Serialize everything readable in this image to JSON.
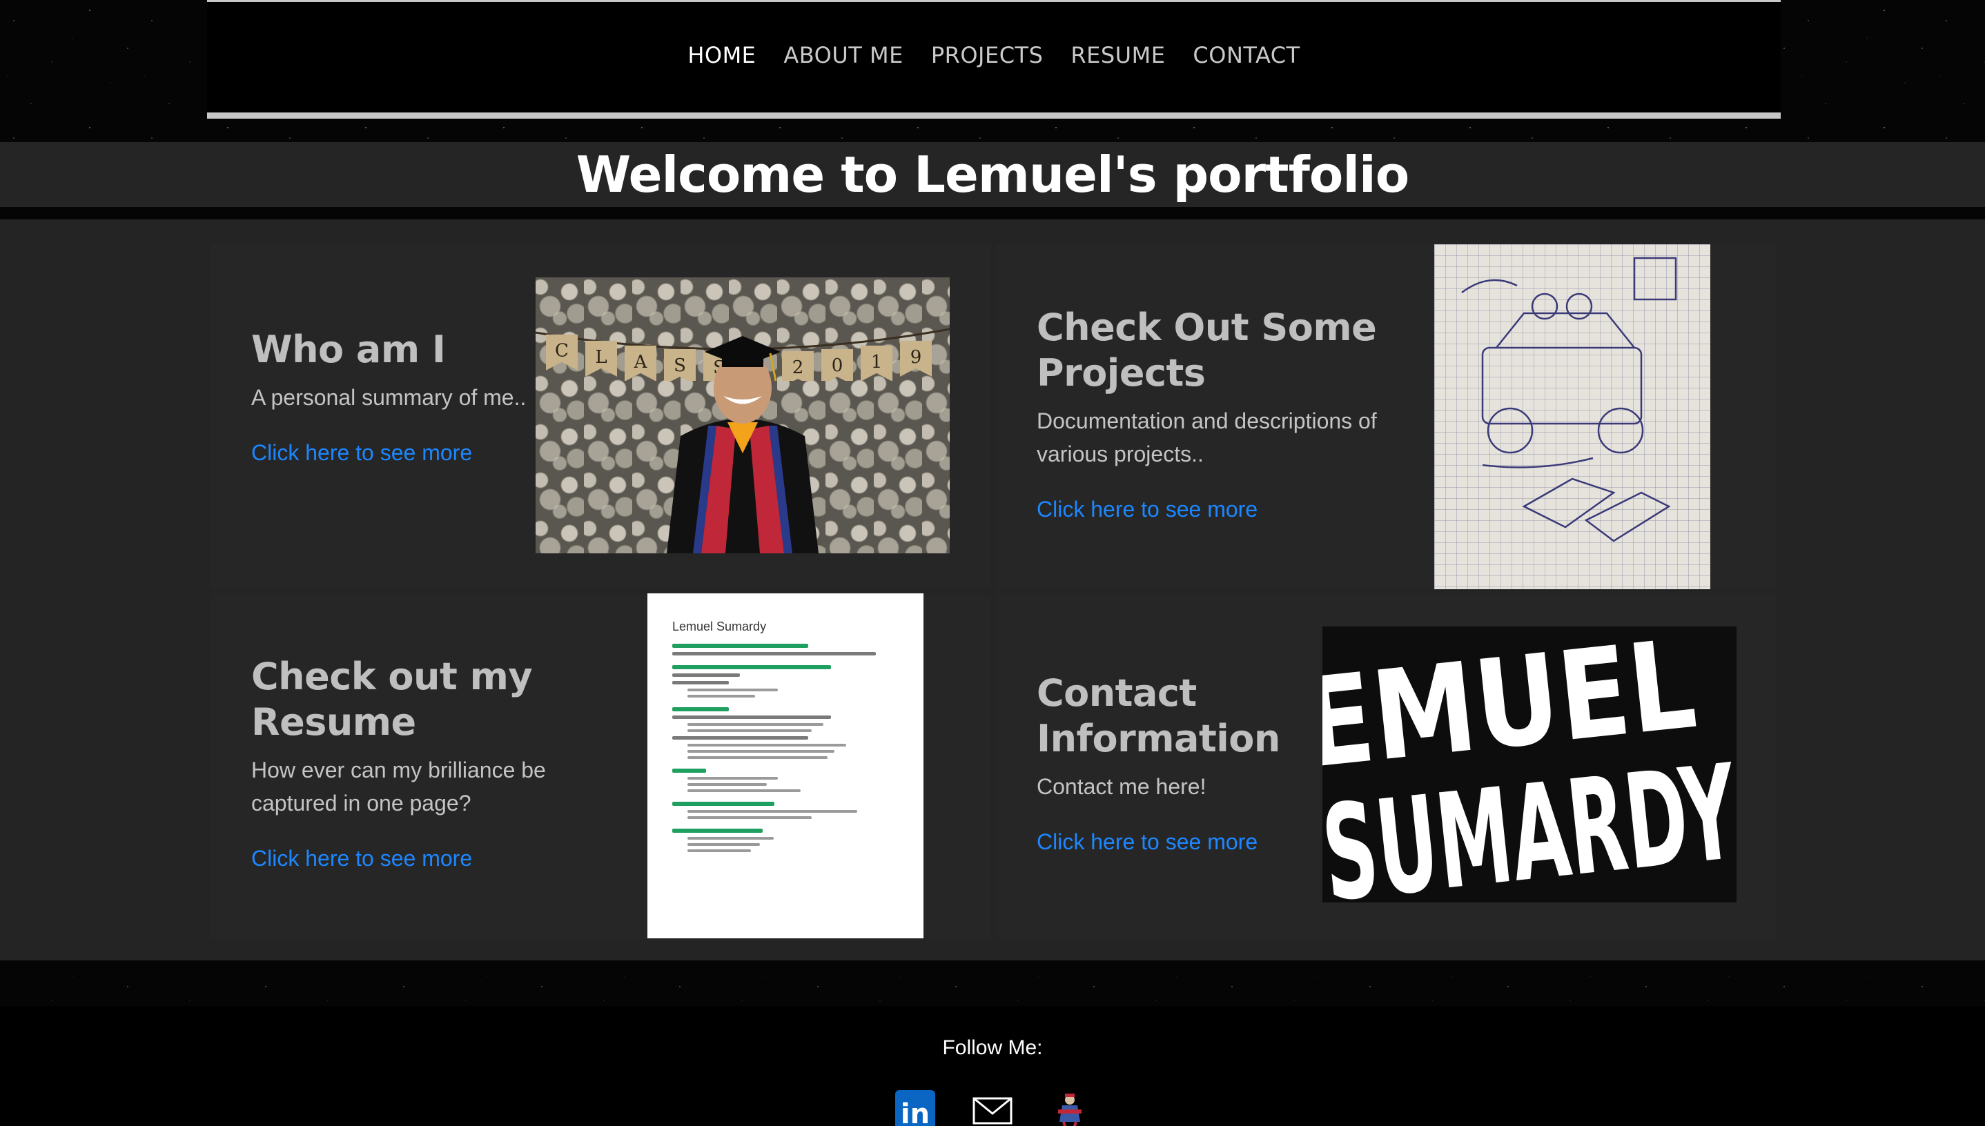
{
  "nav": {
    "items": [
      {
        "label": "HOME",
        "active": true
      },
      {
        "label": "ABOUT ME",
        "active": false
      },
      {
        "label": "PROJECTS",
        "active": false
      },
      {
        "label": "RESUME",
        "active": false
      },
      {
        "label": "CONTACT",
        "active": false
      }
    ]
  },
  "page_title": "Welcome to Lemuel's portfolio",
  "cards": {
    "about": {
      "title": "Who am I",
      "text": "A personal summary of me..",
      "link": "Click here to see more",
      "banner": [
        "C",
        "L",
        "A",
        "S",
        "S",
        "",
        "2",
        "0",
        "1",
        "9"
      ]
    },
    "projects": {
      "title": "Check Out Some Projects",
      "text": "Documentation and descriptions of various projects..",
      "link": "Click here to see more"
    },
    "resume": {
      "title": "Check out my Resume",
      "text": "How ever can my brilliance be captured in one page?",
      "link": "Click here to see more",
      "doc_name": "Lemuel Sumardy"
    },
    "contact": {
      "title": "Contact Information",
      "text": "Contact me here!",
      "link": "Click here to see more",
      "logo_line1": "EMUEL",
      "logo_line2": "SUMARDY"
    }
  },
  "footer": {
    "follow_label": "Follow Me:",
    "socials": [
      {
        "icon": "linkedin-icon",
        "text": "in"
      },
      {
        "icon": "mail-icon"
      },
      {
        "icon": "mascot-icon"
      }
    ]
  },
  "colors": {
    "link": "#1d87ff",
    "linkedin": "#0a66c2"
  }
}
